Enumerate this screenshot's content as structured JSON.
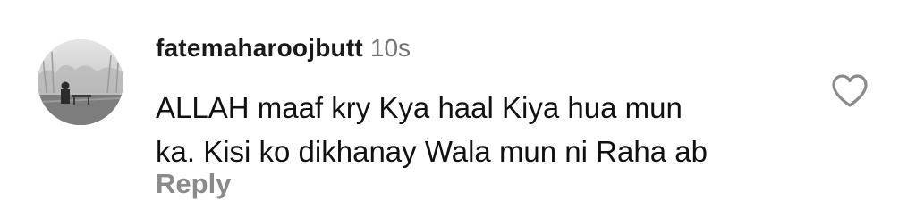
{
  "comment": {
    "username": "fatemaharoojbutt",
    "time": "10s",
    "text_line1": "ALLAH maaf kry Kya haal Kiya hua mun",
    "text_line2": "ka. Kisi ko dikhanay Wala mun ni Raha ab",
    "reply_label": "Reply",
    "like_icon": "heart-outline-icon"
  }
}
